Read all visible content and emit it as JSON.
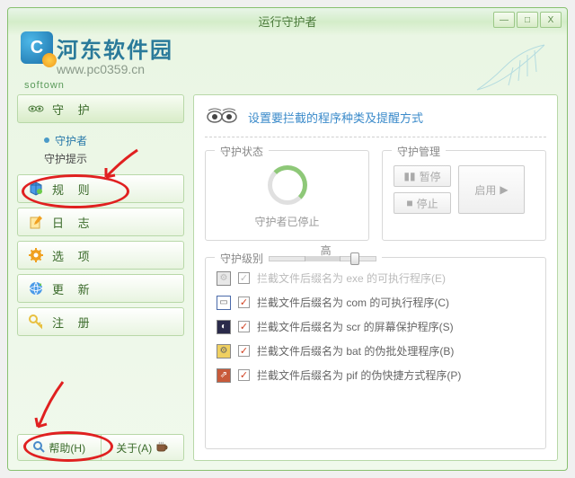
{
  "window": {
    "title": "运行守护者",
    "min": "—",
    "max": "□",
    "close": "X"
  },
  "branding": {
    "name": "河东软件园",
    "url": "www.pc0359.cn",
    "tag": "softown"
  },
  "sidebar": {
    "items": [
      {
        "label": "守 护"
      },
      {
        "label": "规 则"
      },
      {
        "label": "日 志"
      },
      {
        "label": "选 项"
      },
      {
        "label": "更 新"
      },
      {
        "label": "注 册"
      }
    ],
    "sub": {
      "item0": "守护者",
      "item1": "守护提示"
    }
  },
  "bottom": {
    "help": "帮助(H)",
    "about": "关于(A)"
  },
  "main": {
    "title": "设置要拦截的程序种类及提醒方式",
    "status": {
      "legend": "守护状态",
      "text": "守护者已停止"
    },
    "manage": {
      "legend": "守护管理",
      "pause": "暂停",
      "stop": "停止",
      "run": "启用"
    },
    "level": {
      "legend": "守护级别",
      "marks": [
        "",
        "高",
        ""
      ]
    },
    "rules": [
      {
        "text": "拦截文件后缀名为 exe 的可执行程序(E)",
        "checked": true,
        "enabled": false,
        "ico": "exe"
      },
      {
        "text": "拦截文件后缀名为 com 的可执行程序(C)",
        "checked": true,
        "enabled": true,
        "ico": "com"
      },
      {
        "text": "拦截文件后缀名为 scr 的屏幕保护程序(S)",
        "checked": true,
        "enabled": true,
        "ico": "scr"
      },
      {
        "text": "拦截文件后缀名为 bat 的伪批处理程序(B)",
        "checked": true,
        "enabled": true,
        "ico": "bat"
      },
      {
        "text": "拦截文件后缀名为 pif 的伪快捷方式程序(P)",
        "checked": true,
        "enabled": true,
        "ico": "pif"
      }
    ]
  }
}
